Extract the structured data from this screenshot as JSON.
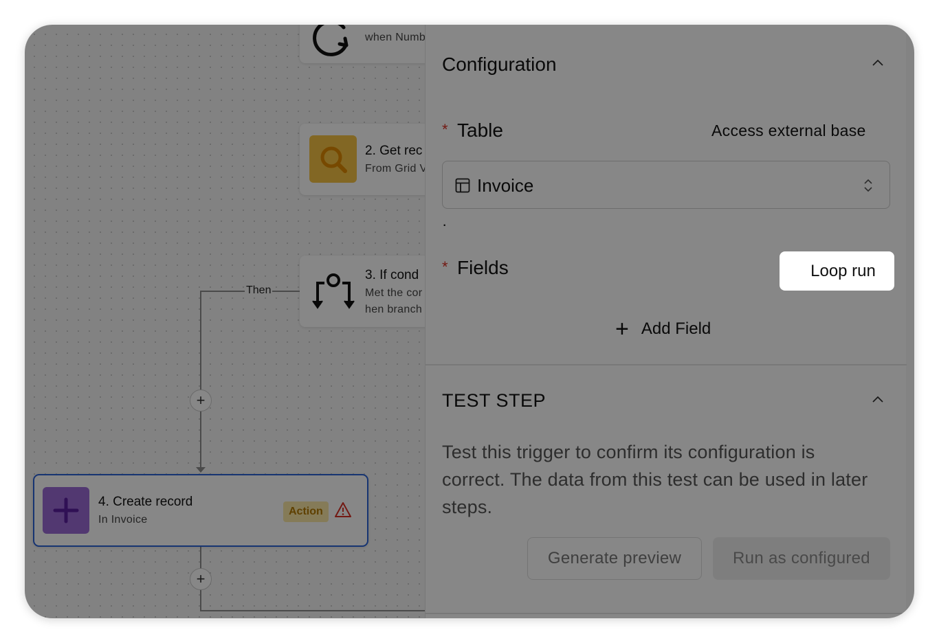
{
  "canvas": {
    "node1": {
      "subtitle": "when Numb"
    },
    "node2": {
      "title": "2. Get rec",
      "subtitle": "From Grid V"
    },
    "node3": {
      "title": "3. If cond",
      "line1": "Met the cor",
      "line2": "hen branch"
    },
    "node4": {
      "title": "4. Create record",
      "subtitle": "In Invoice",
      "badge": "Action"
    },
    "edge_label": "Then",
    "add_symbol": "+"
  },
  "panel": {
    "config_title": "Configuration",
    "table_label": "Table",
    "required_mark": "*",
    "access_external": "Access external base",
    "table_value": "Invoice",
    "dot": "·",
    "fields_label": "Fields",
    "loop_run": "Loop run",
    "add_field": "Add Field",
    "test_title": "TEST STEP",
    "test_description": "Test this trigger to confirm its configuration is correct. The data from this test can be used in later steps.",
    "generate_preview": "Generate preview",
    "run_as_configured": "Run as configured"
  },
  "colors": {
    "accent_blue": "#2a62d8",
    "badge_bg": "#fbe9a7",
    "badge_text": "#b47a00",
    "warning_red": "#d93025",
    "get_icon_bg": "#f6c344",
    "create_icon_bg": "#9b6bd6"
  }
}
